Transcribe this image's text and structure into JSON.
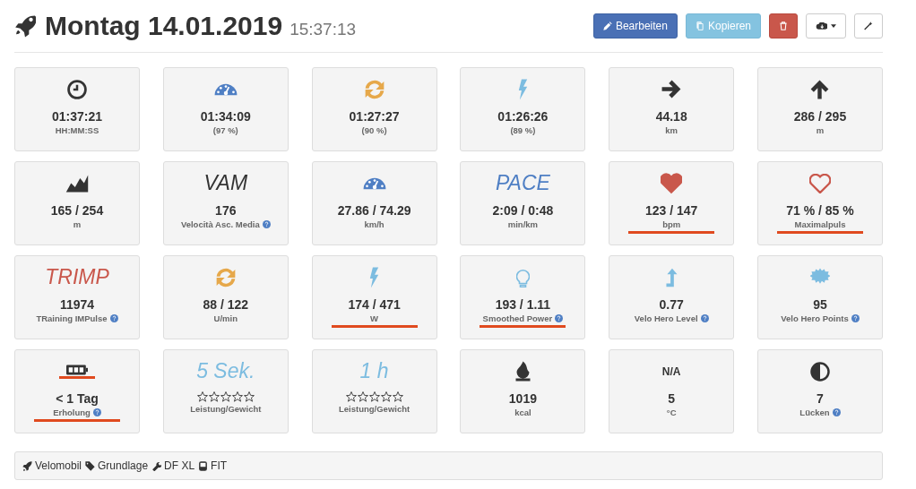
{
  "header": {
    "title": "Montag 14.01.2019",
    "time": "15:37:13"
  },
  "buttons": [
    {
      "kind": "edit",
      "label": "Bearbeiten"
    },
    {
      "kind": "copy",
      "label": "Kopieren"
    },
    {
      "kind": "delete"
    },
    {
      "kind": "cloud"
    },
    {
      "kind": "wand"
    }
  ],
  "tiles": [
    {
      "kind": "clock",
      "color": "#333333",
      "value": "01:37:21",
      "label": "HH:MM:SS"
    },
    {
      "kind": "gauge",
      "color": "#4f7fc4",
      "value": "01:34:09",
      "label": "(97 %)"
    },
    {
      "kind": "sync",
      "color": "#e6a84a",
      "value": "01:27:27",
      "label": "(90 %)"
    },
    {
      "kind": "bolt",
      "color": "#7cbce0",
      "value": "01:26:26",
      "label": "(89 %)"
    },
    {
      "kind": "arrow-right",
      "color": "#333333",
      "value": "44.18",
      "label": "km"
    },
    {
      "kind": "arrow-up",
      "color": "#333333",
      "value": "286 / 295",
      "label": "m"
    },
    {
      "kind": "area",
      "color": "#333333",
      "value": "165 / 254",
      "label": "m"
    },
    {
      "kind": "title",
      "title": "VAM",
      "color": "#333333",
      "value": "176",
      "label": "Velocità Asc. Media",
      "help": true
    },
    {
      "kind": "gauge",
      "color": "#4f7fc4",
      "value": "27.86 / 74.29",
      "label": "km/h"
    },
    {
      "kind": "title",
      "title": "PACE",
      "color": "#4f7fc4",
      "value": "2:09 / 0:48",
      "label": "min/km"
    },
    {
      "kind": "heart",
      "color": "#c9574b",
      "value": "123 / 147",
      "label": "bpm",
      "highlight": true
    },
    {
      "kind": "heart-outline",
      "color": "#c9574b",
      "value": "71 % / 85 %",
      "label": "Maximalpuls",
      "highlight": true
    },
    {
      "kind": "title",
      "title": "TRIMP",
      "color": "#c9574b",
      "value": "11974",
      "label": "TRaining IMPulse",
      "help": true
    },
    {
      "kind": "sync",
      "color": "#e6a84a",
      "value": "88 / 122",
      "label": "U/min"
    },
    {
      "kind": "bolt",
      "color": "#7cbce0",
      "value": "174 / 471",
      "label": "W",
      "highlight": true
    },
    {
      "kind": "bulb",
      "color": "#7cbce0",
      "value": "193 / 1.11",
      "label": "Smoothed Power",
      "help": true,
      "highlight": true
    },
    {
      "kind": "level-up",
      "color": "#7cbce0",
      "value": "0.77",
      "label": "Velo Hero Level",
      "help": true
    },
    {
      "kind": "burst",
      "color": "#7cbce0",
      "value": "95",
      "label": "Velo Hero Points",
      "help": true
    },
    {
      "kind": "battery",
      "color": "#333333",
      "icon_highlight": true,
      "value": "< 1 Tag",
      "label": "Erholung",
      "help": true,
      "highlight": true
    },
    {
      "kind": "title",
      "title": "5 Sek.",
      "color": "#7cbce0",
      "stars": 0,
      "label": "Leistung/Gewicht"
    },
    {
      "kind": "title",
      "title": "1 h",
      "color": "#7cbce0",
      "stars": 0,
      "label": "Leistung/Gewicht"
    },
    {
      "kind": "fire",
      "color": "#333333",
      "value": "1019",
      "label": "kcal"
    },
    {
      "kind": "caption",
      "title": "N/A",
      "value": "5",
      "label": "°C"
    },
    {
      "kind": "contrast",
      "color": "#333333",
      "value": "7",
      "label": "Lücken",
      "help": true
    }
  ],
  "footer": [
    {
      "kind": "rocket",
      "text": "Velomobil"
    },
    {
      "kind": "tag",
      "text": "Grundlage"
    },
    {
      "kind": "wrench",
      "text": "DF XL"
    },
    {
      "kind": "device",
      "text": "FIT"
    }
  ]
}
